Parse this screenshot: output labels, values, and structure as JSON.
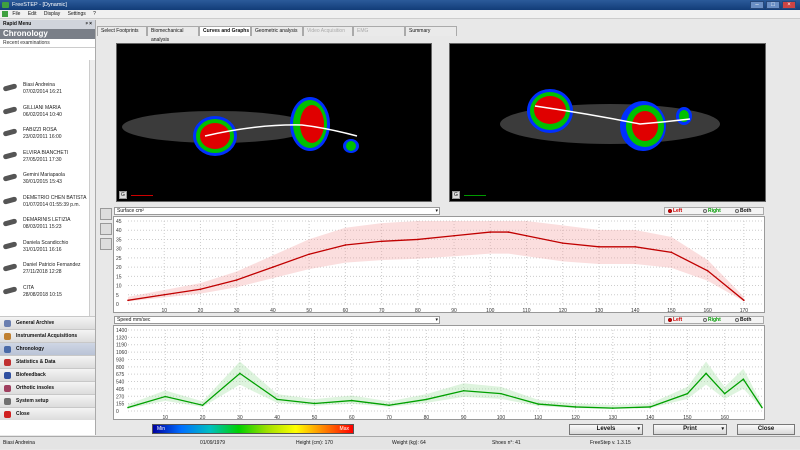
{
  "window": {
    "title": "FreeSTEP - [Dynamic]"
  },
  "menu": {
    "items": [
      "File",
      "Edit",
      "Display",
      "Settings",
      "?"
    ]
  },
  "sidebar": {
    "header": "Rapid Menu",
    "section": "Chronology",
    "recent_label": "Recent examinations",
    "patients": [
      {
        "name": "Biasi Andreina",
        "date": "07/02/2014 16:21"
      },
      {
        "name": "GILLIANI MARIA",
        "date": "06/02/2014 10:40"
      },
      {
        "name": "FABIZZI ROSA",
        "date": "23/02/2011 16:00"
      },
      {
        "name": "ELVIRA BIANCHETI",
        "date": "27/05/2011 17:30"
      },
      {
        "name": "Gemini Mariapaola",
        "date": "30/01/2015 15:43"
      },
      {
        "name": "DEMETRIO CHEN BATISTA",
        "date": "01/07/2014 01:55:39 p.m."
      },
      {
        "name": "DEMARINIS LETIZIA",
        "date": "08/03/2011 15:23"
      },
      {
        "name": "Daniela Scandicchio",
        "date": "31/01/2011 16:16"
      },
      {
        "name": "Daniel Patricio Fernandez",
        "date": "27/11/2018 12:28"
      },
      {
        "name": "CITA",
        "date": "28/08/2018 10:15"
      }
    ],
    "nav": [
      {
        "label": "General Archive",
        "color": "#6b7fb0"
      },
      {
        "label": "Instrumental Acquisitions",
        "color": "#c08030"
      },
      {
        "label": "Chronology",
        "color": "#4a6aa8"
      },
      {
        "label": "Statistics & Data",
        "color": "#c03030"
      },
      {
        "label": "Biofeedback",
        "color": "#3050a0"
      },
      {
        "label": "Orthotic insoles",
        "color": "#a04060"
      },
      {
        "label": "System setup",
        "color": "#707070"
      },
      {
        "label": "Close",
        "color": "#d02020"
      }
    ]
  },
  "tabs": [
    {
      "label": "Select Footprints",
      "state": "normal"
    },
    {
      "label": "Biomechanical analysis",
      "state": "normal"
    },
    {
      "label": "Curves and Graphs",
      "state": "active"
    },
    {
      "label": "Geometric analysis",
      "state": "normal"
    },
    {
      "label": "Video Acquisition",
      "state": "disabled"
    },
    {
      "label": "EMG",
      "state": "disabled"
    },
    {
      "label": "Summary",
      "state": "normal"
    }
  ],
  "footprint_view": {
    "left_button": "G",
    "right_button": "G"
  },
  "surface_chart": {
    "selector": "Surface cm²",
    "radio": {
      "left": "Left",
      "right": "Right",
      "both": "Both",
      "selected": "Left"
    },
    "y_ticks": [
      "45",
      "40",
      "35",
      "30",
      "25",
      "20",
      "15",
      "10",
      "5",
      "0"
    ],
    "x_ticks": [
      "10",
      "20",
      "30",
      "40",
      "50",
      "60",
      "70",
      "80",
      "90",
      "100",
      "110",
      "120",
      "130",
      "140",
      "150",
      "160",
      "170"
    ]
  },
  "speed_chart": {
    "selector": "Speed mm/sec",
    "radio": {
      "left": "Left",
      "right": "Right",
      "both": "Both",
      "selected": "Left"
    },
    "y_ticks": [
      "1400",
      "1320",
      "1190",
      "1060",
      "930",
      "800",
      "675",
      "540",
      "405",
      "270",
      "155",
      "0"
    ],
    "x_ticks": [
      "10",
      "20",
      "30",
      "40",
      "50",
      "60",
      "70",
      "80",
      "90",
      "100",
      "110",
      "120",
      "130",
      "140",
      "150",
      "160"
    ]
  },
  "chart_data": [
    {
      "type": "line",
      "title": "",
      "ylabel": "Surface cm²",
      "xlabel": "",
      "ylim": [
        0,
        45
      ],
      "xlim": [
        0,
        175
      ],
      "series": [
        {
          "name": "Left",
          "color": "#c00000",
          "x": [
            0,
            10,
            20,
            30,
            40,
            50,
            60,
            70,
            80,
            90,
            100,
            105,
            110,
            120,
            130,
            140,
            150,
            160,
            170
          ],
          "y": [
            2,
            5,
            8,
            13,
            20,
            27,
            32,
            34,
            35,
            37,
            39,
            39,
            37,
            33,
            31,
            31,
            28,
            18,
            2
          ]
        }
      ]
    },
    {
      "type": "line",
      "title": "",
      "ylabel": "Speed mm/sec",
      "xlabel": "",
      "ylim": [
        0,
        1400
      ],
      "xlim": [
        0,
        170
      ],
      "series": [
        {
          "name": "Left",
          "color": "#00a000",
          "x": [
            0,
            10,
            20,
            30,
            40,
            50,
            60,
            70,
            80,
            90,
            100,
            110,
            120,
            130,
            140,
            150,
            155,
            160,
            165,
            170
          ],
          "y": [
            60,
            250,
            100,
            650,
            200,
            130,
            180,
            100,
            200,
            350,
            300,
            120,
            70,
            50,
            70,
            300,
            650,
            300,
            550,
            60
          ]
        }
      ]
    }
  ],
  "colorbar": {
    "min": "Min",
    "max": "Max"
  },
  "buttons": {
    "levels": "Levels",
    "print": "Print",
    "close": "Close"
  },
  "status": {
    "patient": "Biasi Andreina",
    "dob": "01/09/1979",
    "height": "Height (cm): 170",
    "weight": "Weight (kg): 64",
    "shoes": "Shoes n°: 41",
    "version": "FreeStep v. 1.3.15"
  }
}
